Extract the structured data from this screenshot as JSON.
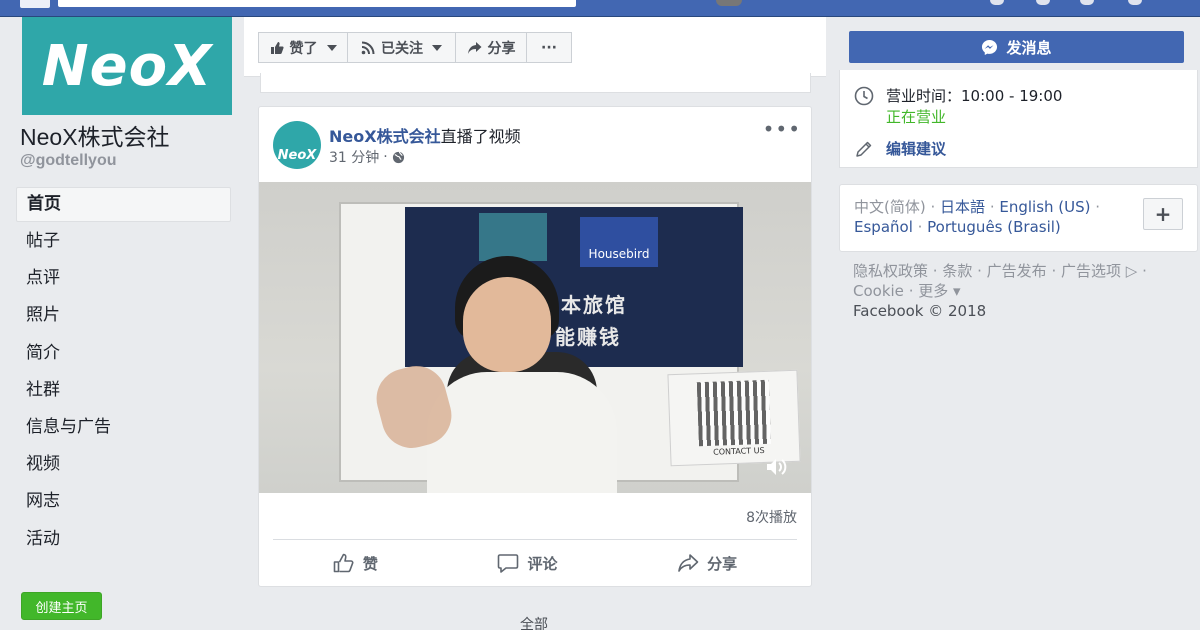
{
  "page": {
    "logo_text": "NeoX",
    "name": "NeoX株式会社",
    "handle": "@godtellyou"
  },
  "nav": {
    "items": [
      "首页",
      "帖子",
      "点评",
      "照片",
      "简介",
      "社群",
      "信息与广告",
      "视频",
      "网志",
      "活动"
    ],
    "create_page": "创建主页"
  },
  "actionbar": {
    "liked": "赞了",
    "following": "已关注",
    "share": "分享",
    "more": "···"
  },
  "post": {
    "author": "NeoX株式会社",
    "action": "直播了视频",
    "time": "31 分钟",
    "avatar_text": "NeoX",
    "video": {
      "banner_sign": "Housebird",
      "banner_line1": "投资日本旅馆",
      "banner_line2": "能赚钱",
      "qr_caption": "CONTACT US"
    },
    "views": "8次播放",
    "like": "赞",
    "comment": "评论",
    "share": "分享"
  },
  "all_link": "全部",
  "sidebar": {
    "send_message": "发消息",
    "hours_label": "营业时间：",
    "hours_value": "10:00 - 19:00",
    "open_status": "正在营业",
    "edit_suggest": "编辑建议"
  },
  "languages": {
    "current": "中文(简体)",
    "links": [
      "日本語",
      "English (US)",
      "Español",
      "Português (Brasil)"
    ]
  },
  "footer": {
    "links": [
      "隐私权政策",
      "条款",
      "广告发布",
      "广告选项",
      "Cookie",
      "更多"
    ],
    "copyright": "Facebook © 2018"
  },
  "colors": {
    "fb_blue": "#4267b2",
    "link_blue": "#365899",
    "green": "#42b72a",
    "brand_teal": "#2fa7a9"
  }
}
